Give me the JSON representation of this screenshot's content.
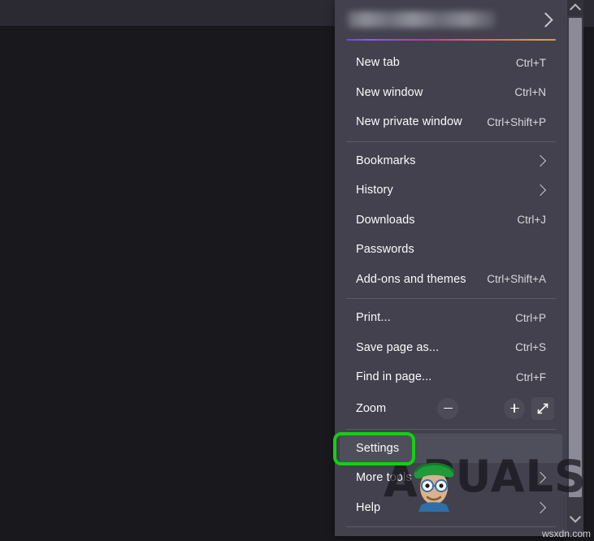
{
  "window": {
    "background_color": "#19181d",
    "toolbar_color": "#2b2a33"
  },
  "menu": {
    "panel_color": "#42414d",
    "account": {
      "name_redacted": "",
      "chevron_icon": "chevron-right-icon"
    },
    "items": [
      {
        "label": "New tab",
        "shortcut": "Ctrl+T",
        "submenu": false
      },
      {
        "label": "New window",
        "shortcut": "Ctrl+N",
        "submenu": false
      },
      {
        "label": "New private window",
        "shortcut": "Ctrl+Shift+P",
        "submenu": false
      },
      {
        "label": "Bookmarks",
        "shortcut": "",
        "submenu": true
      },
      {
        "label": "History",
        "shortcut": "",
        "submenu": true
      },
      {
        "label": "Downloads",
        "shortcut": "Ctrl+J",
        "submenu": false
      },
      {
        "label": "Passwords",
        "shortcut": "",
        "submenu": false
      },
      {
        "label": "Add-ons and themes",
        "shortcut": "Ctrl+Shift+A",
        "submenu": false
      },
      {
        "label": "Print...",
        "shortcut": "Ctrl+P",
        "submenu": false
      },
      {
        "label": "Save page as...",
        "shortcut": "Ctrl+S",
        "submenu": false
      },
      {
        "label": "Find in page...",
        "shortcut": "Ctrl+F",
        "submenu": false
      }
    ],
    "zoom": {
      "label": "Zoom",
      "minus_icon": "minus-icon",
      "plus_icon": "plus-icon",
      "fullscreen_icon": "fullscreen-expand-icon"
    },
    "settings": {
      "label": "Settings",
      "hovered": true
    },
    "more_tools": {
      "label": "More tools",
      "submenu": true
    },
    "help": {
      "label": "Help",
      "submenu": true
    }
  },
  "annotation": {
    "target": "Settings",
    "color": "#13d013",
    "shape": "rounded-rectangle-outline"
  },
  "scrollbar": {
    "up_arrow_icon": "chevron-up-icon",
    "down_arrow_icon": "chevron-down-icon",
    "thumb_color": "#8b8a97"
  },
  "watermarks": {
    "brand": "PUALS",
    "brand_initial": "A",
    "site_credit": "wsxdn.com"
  }
}
